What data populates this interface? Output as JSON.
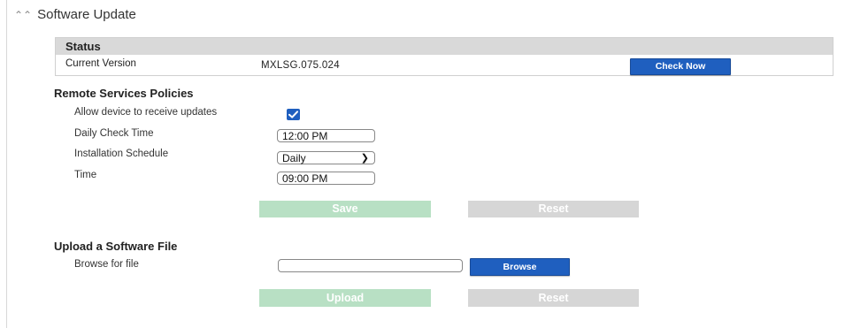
{
  "header": {
    "title": "Software Update",
    "collapse_icon": "chevron-double-up-icon"
  },
  "status": {
    "heading": "Status",
    "current_version_label": "Current Version",
    "current_version_value": "MXLSG.075.024",
    "check_now_label": "Check Now"
  },
  "policies": {
    "heading": "Remote Services Policies",
    "allow_updates_label": "Allow device to receive updates",
    "allow_updates_checked": true,
    "daily_check_label": "Daily Check Time",
    "daily_check_value": "12:00 PM",
    "schedule_label": "Installation Schedule",
    "schedule_value": "Daily",
    "time_label": "Time",
    "time_value": "09:00 PM",
    "save_label": "Save",
    "reset_label": "Reset"
  },
  "upload": {
    "heading": "Upload a Software File",
    "browse_label": "Browse for file",
    "file_value": "",
    "browse_button_label": "Browse",
    "upload_label": "Upload",
    "reset_label": "Reset"
  },
  "colors": {
    "accent": "#1f5fbf",
    "save_green": "#b8e0c4",
    "disabled_gray": "#d6d6d6"
  }
}
